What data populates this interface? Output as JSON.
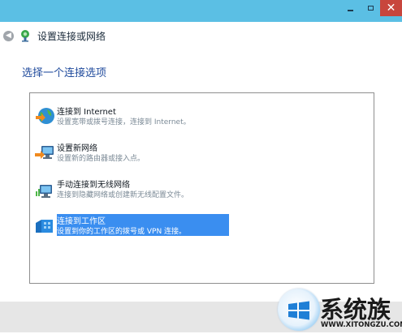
{
  "window": {
    "title": "设置连接或网络",
    "minimize_icon": "minimize-icon",
    "maximize_icon": "maximize-icon",
    "close_label": "✕"
  },
  "page": {
    "heading": "选择一个连接选项"
  },
  "options": [
    {
      "title": "连接到 Internet",
      "description": "设置宽带或拨号连接，连接到 Internet。",
      "icon": "internet-globe-icon",
      "selected": false
    },
    {
      "title": "设置新网络",
      "description": "设置新的路由器或接入点。",
      "icon": "new-network-icon",
      "selected": false
    },
    {
      "title": "手动连接到无线网络",
      "description": "连接到隐藏网络或创建新无线配置文件。",
      "icon": "wireless-network-icon",
      "selected": false
    },
    {
      "title": "连接到工作区",
      "description": "设置到你的工作区的拨号或 VPN 连接。",
      "icon": "workplace-icon",
      "selected": true
    }
  ],
  "watermark": {
    "text": "系统族",
    "url": "WWW.XITONGZU.COM"
  },
  "colors": {
    "titlebar": "#5bbfe4",
    "heading": "#1f4a9c",
    "selection": "#3a8ef0",
    "close": "#c8463d"
  }
}
